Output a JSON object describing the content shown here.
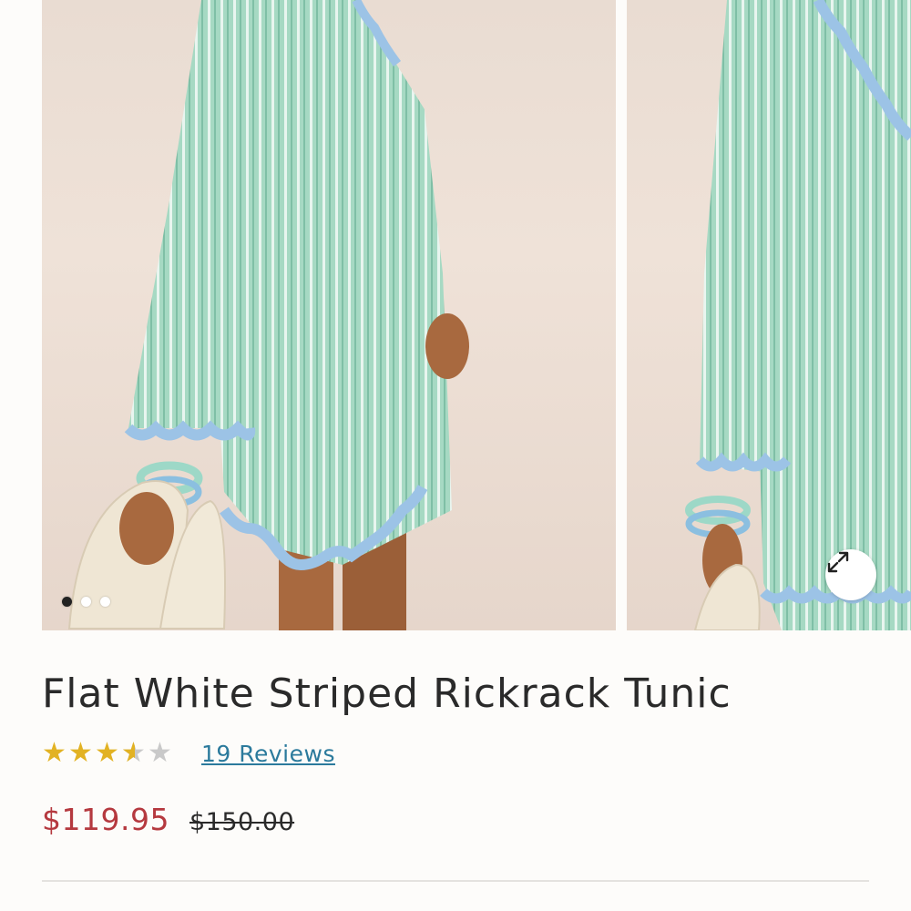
{
  "product": {
    "title": "Flat White Striped Rickrack Tunic",
    "rating": {
      "value": 3.5,
      "max": 5,
      "star_color": "#e2b223",
      "empty_color": "#c9c9c9"
    },
    "reviews_label": "19 Reviews",
    "price": {
      "sale": "$119.95",
      "original": "$150.00",
      "sale_color": "#b5393f"
    }
  },
  "gallery": {
    "images": [
      {
        "alt": "Model wearing striped rickrack tunic holding sandals",
        "icon": "product-photo"
      },
      {
        "alt": "Side view of striped rickrack tunic",
        "icon": "product-photo"
      }
    ],
    "dots": {
      "count": 3,
      "active_index": 0
    },
    "expand_icon": "expand-arrows-icon"
  },
  "colors": {
    "tunic_green": "#9fd3bd",
    "rickrack_blue": "#9cc3e6",
    "sand": "#ece0d6"
  }
}
